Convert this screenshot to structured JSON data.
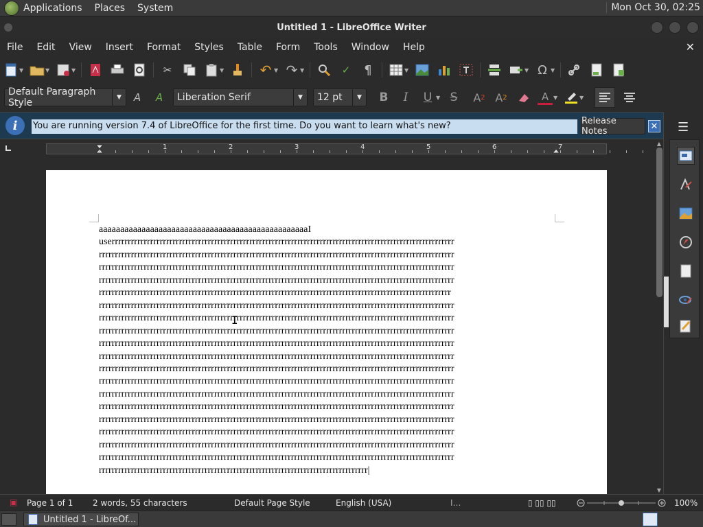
{
  "top_panel": {
    "menus": [
      "Applications",
      "Places",
      "System"
    ],
    "clock": "Mon Oct 30, 02:25"
  },
  "window": {
    "title": "Untitled 1 - LibreOffice Writer"
  },
  "menubar": [
    "File",
    "Edit",
    "View",
    "Insert",
    "Format",
    "Styles",
    "Table",
    "Form",
    "Tools",
    "Window",
    "Help"
  ],
  "formatting": {
    "paragraph_style": "Default Paragraph Style",
    "font_name": "Liberation Serif",
    "font_size": "12 pt"
  },
  "infobar": {
    "message": "You are running version 7.4 of LibreOffice for the first time. Do you want to learn what's new?",
    "button": "Release Notes",
    "icon": "info-icon"
  },
  "ruler": {
    "numbers": [
      "1",
      "2",
      "3",
      "4",
      "5",
      "6",
      "7"
    ]
  },
  "document": {
    "lines": [
      "aaaaaaaaaaaaaaaaaaaaaaaaaaaaaaaaaaaaaaaaaaaaaaaaaI",
      "userrrrrrrrrrrrrrrrrrrrrrrrrrrrrrrrrrrrrrrrrrrrrrrrrrrrrrrrrrrrrrrrrrrrrrrrrrrrrrrrrrrrrrrrrrrrrrrrrrrrrrrrrrr",
      "rrrrrrrrrrrrrrrrrrrrrrrrrrrrrrrrrrrrrrrrrrrrrrrrrrrrrrrrrrrrrrrrrrrrrrrrrrrrrrrrrrrrrrrrrrrrrrrrrrrrrrrrrrrrrrr",
      "rrrrrrrrrrrrrrrrrrrrrrrrrrrrrrrrrrrrrrrrrrrrrrrrrrrrrrrrrrrrrrrrrrrrrrrrrrrrrrrrrrrrrrrrrrrrrrrrrrrrrrrrrrrrrrr",
      "rrrrrrrrrrrrrrrrrrrrrrrrrrrrrrrrrrrrrrrrrrrrrrrrrrrrrrrrrrrrrrrrrrrrrrrrrrrrrrrrrrrrrrrrrrrrrrrrrrrrrrrrrrrrrrr",
      "rrrrrrrrrrrrrrrrrrrrrrrrrrrrrrrrrrrrrrrrrrrrrrrrrrrrrrrrrrrrrrrrrrrrrrrrrrrrrrrrrrrrrrrrrrrrrrrrrrrrrrrrrrrrrr",
      "rrrrrrrrrrrrrrrrrrrrrrrrrrrrrrrrrrrrrrrrrrrrrrrrrrrrrrrrrrrrrrrrrrrrrrrrrrrrrrrrrrrrrrrrrrrrrrrrrrrrrrrrrrrrrrr",
      "rrrrrrrrrrrrrrrrrrrrrrrrrrrrrrrrrrrrrrrrrrrrrrrrrrrrrrrrrrrrrrrrrrrrrrrrrrrrrrrrrrrrrrrrrrrrrrrrrrrrrrrrrrrrrrr",
      "rrrrrrrrrrrrrrrrrrrrrrrrrrrrrrrrrrrrrrrrrrrrrrrrrrrrrrrrrrrrrrrrrrrrrrrrrrrrrrrrrrrrrrrrrrrrrrrrrrrrrrrrrrrrrrr",
      "rrrrrrrrrrrrrrrrrrrrrrrrrrrrrrrrrrrrrrrrrrrrrrrrrrrrrrrrrrrrrrrrrrrrrrrrrrrrrrrrrrrrrrrrrrrrrrrrrrrrrrrrrrrrrrr",
      "rrrrrrrrrrrrrrrrrrrrrrrrrrrrrrrrrrrrrrrrrrrrrrrrrrrrrrrrrrrrrrrrrrrrrrrrrrrrrrrrrrrrrrrrrrrrrrrrrrrrrrrrrrrrrrr",
      "rrrrrrrrrrrrrrrrrrrrrrrrrrrrrrrrrrrrrrrrrrrrrrrrrrrrrrrrrrrrrrrrrrrrrrrrrrrrrrrrrrrrrrrrrrrrrrrrrrrrrrrrrrrrrrr",
      "rrrrrrrrrrrrrrrrrrrrrrrrrrrrrrrrrrrrrrrrrrrrrrrrrrrrrrrrrrrrrrrrrrrrrrrrrrrrrrrrrrrrrrrrrrrrrrrrrrrrrrrrrrrrrrr",
      "rrrrrrrrrrrrrrrrrrrrrrrrrrrrrrrrrrrrrrrrrrrrrrrrrrrrrrrrrrrrrrrrrrrrrrrrrrrrrrrrrrrrrrrrrrrrrrrrrrrrrrrrrrrrrrr",
      "rrrrrrrrrrrrrrrrrrrrrrrrrrrrrrrrrrrrrrrrrrrrrrrrrrrrrrrrrrrrrrrrrrrrrrrrrrrrrrrrrrrrrrrrrrrrrrrrrrrrrrrrrrrrrrr",
      "rrrrrrrrrrrrrrrrrrrrrrrrrrrrrrrrrrrrrrrrrrrrrrrrrrrrrrrrrrrrrrrrrrrrrrrrrrrrrrrrrrrrrrrrrrrrrrrrrrrrrrrrrrrrrrr",
      "rrrrrrrrrrrrrrrrrrrrrrrrrrrrrrrrrrrrrrrrrrrrrrrrrrrrrrrrrrrrrrrrrrrrrrrrrrrrrrrrrrrrrrrrrrrrrrrrrrrrrrrrrrrrrrr",
      "rrrrrrrrrrrrrrrrrrrrrrrrrrrrrrrrrrrrrrrrrrrrrrrrrrrrrrrrrrrrrrrrrrrrrrrrrrrrrrrrrrrrrrrrrrrrrrrrrrrrrrrrrrrrrrr",
      "rrrrrrrrrrrrrrrrrrrrrrrrrrrrrrrrrrrrrrrrrrrrrrrrrrrrrrrrrrrrrrrrrrrrrrrrrrrrrrrrrrrrrrrrrrrrrrrrrrrrrrrrrrrrrrr",
      "rrrrrrrrrrrrrrrrrrrrrrrrrrrrrrrrrrrrrrrrrrrrrrrrrrrrrrrrrrrrrrrrrrrrrrrrrrrrrrrrrrrr|"
    ]
  },
  "statusbar": {
    "page": "Page 1 of 1",
    "words": "2 words, 55 characters",
    "page_style": "Default Page Style",
    "language": "English (USA)",
    "zoom": "100%"
  },
  "taskbar": {
    "task_label": "Untitled 1 - LibreOf..."
  },
  "colors": {
    "infobar_message_bg": "#c9ddf0",
    "accent_blue": "#3b6fb6",
    "page": "#ffffff"
  }
}
